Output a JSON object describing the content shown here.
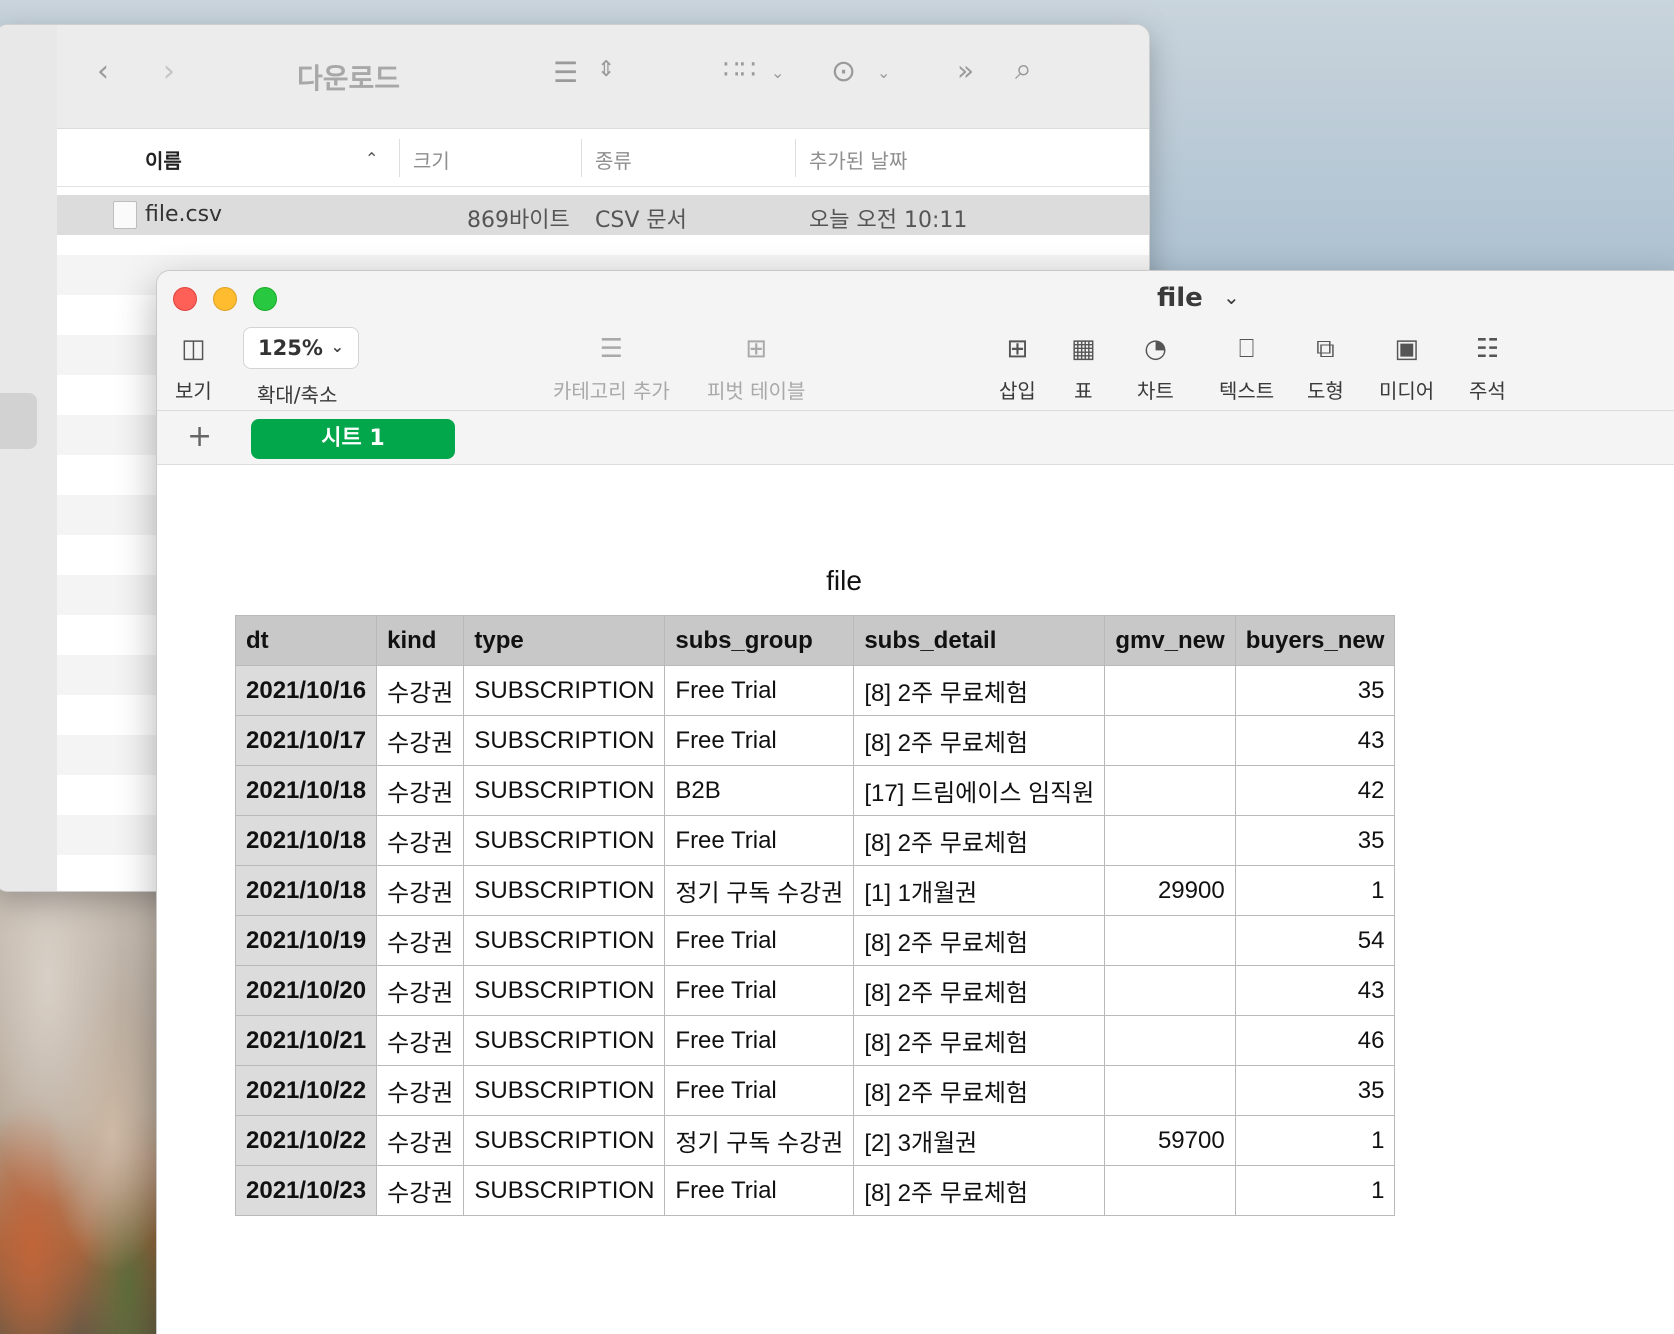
{
  "finder": {
    "title": "다운로드",
    "columns": {
      "name": "이름",
      "size": "크기",
      "kind": "종류",
      "date_added": "추가된 날짜"
    },
    "file": {
      "name": "file.csv",
      "size": "869바이트",
      "kind": "CSV 문서",
      "date_added": "오늘 오전 10:11"
    }
  },
  "numbers": {
    "doc_title": "file",
    "toolbar": {
      "view": "보기",
      "zoom_value": "125%",
      "zoom": "확대/축소",
      "add_category": "카테고리 추가",
      "pivot_table": "피벗 테이블",
      "insert": "삽입",
      "table": "표",
      "chart": "차트",
      "text": "텍스트",
      "shape": "도형",
      "media": "미디어",
      "comment": "주석"
    },
    "sheet_tab": "시트 1",
    "table_title": "file",
    "headers": [
      "dt",
      "kind",
      "type",
      "subs_group",
      "subs_detail",
      "gmv_new",
      "buyers_new"
    ],
    "rows": [
      [
        "2021/10/16",
        "수강권",
        "SUBSCRIPTION",
        "Free Trial",
        "[8] 2주 무료체험",
        "",
        "35"
      ],
      [
        "2021/10/17",
        "수강권",
        "SUBSCRIPTION",
        "Free Trial",
        "[8] 2주 무료체험",
        "",
        "43"
      ],
      [
        "2021/10/18",
        "수강권",
        "SUBSCRIPTION",
        "B2B",
        "[17] 드림에이스 임직원",
        "",
        "42"
      ],
      [
        "2021/10/18",
        "수강권",
        "SUBSCRIPTION",
        "Free Trial",
        "[8] 2주 무료체험",
        "",
        "35"
      ],
      [
        "2021/10/18",
        "수강권",
        "SUBSCRIPTION",
        "정기 구독 수강권",
        "[1] 1개월권",
        "29900",
        "1"
      ],
      [
        "2021/10/19",
        "수강권",
        "SUBSCRIPTION",
        "Free Trial",
        "[8] 2주 무료체험",
        "",
        "54"
      ],
      [
        "2021/10/20",
        "수강권",
        "SUBSCRIPTION",
        "Free Trial",
        "[8] 2주 무료체험",
        "",
        "43"
      ],
      [
        "2021/10/21",
        "수강권",
        "SUBSCRIPTION",
        "Free Trial",
        "[8] 2주 무료체험",
        "",
        "46"
      ],
      [
        "2021/10/22",
        "수강권",
        "SUBSCRIPTION",
        "Free Trial",
        "[8] 2주 무료체험",
        "",
        "35"
      ],
      [
        "2021/10/22",
        "수강권",
        "SUBSCRIPTION",
        "정기 구독 수강권",
        "[2] 3개월권",
        "59700",
        "1"
      ],
      [
        "2021/10/23",
        "수강권",
        "SUBSCRIPTION",
        "Free Trial",
        "[8] 2주 무료체험",
        "",
        "1"
      ]
    ]
  }
}
